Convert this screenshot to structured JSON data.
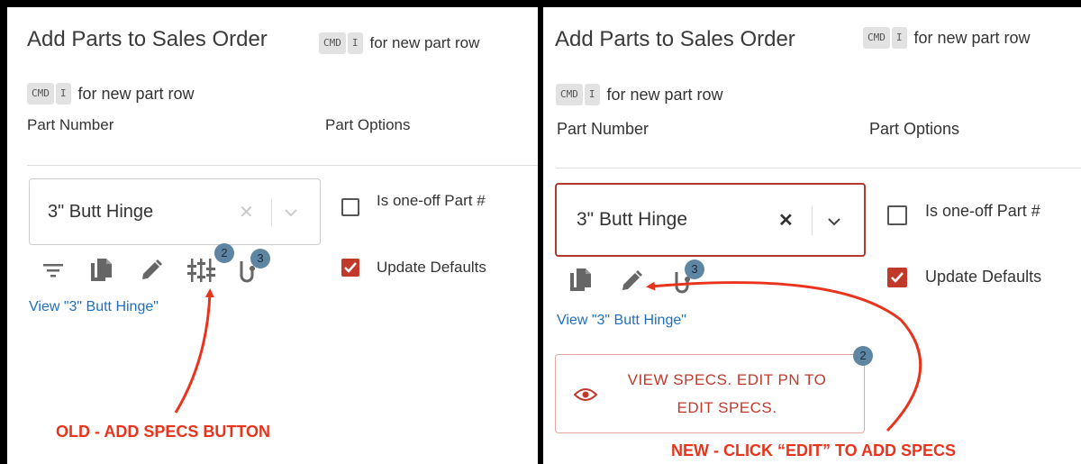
{
  "colors": {
    "accent_red": "#c0392b",
    "arrow_red": "#e8341c",
    "badge_blue": "#5e86a3",
    "link_blue": "#1f6fc0"
  },
  "left": {
    "title": "Add Parts to Sales Order",
    "hint_top": {
      "keys": [
        "CMD",
        "I"
      ],
      "text": "for new part row"
    },
    "hint_row": {
      "keys": [
        "CMD",
        "I"
      ],
      "text": "for new part row"
    },
    "col_part_number": "Part Number",
    "col_part_options": "Part Options",
    "part_select": {
      "value": "3\" Butt Hinge",
      "clear_icon": "close-icon",
      "dropdown_icon": "chevron-down-icon"
    },
    "toolbar_icons": [
      "filter-icon",
      "copy-icon",
      "edit-pencil-icon",
      "specs-icon",
      "hook-icon"
    ],
    "specs_badge": "2",
    "hook_badge": "3",
    "checkbox_one_off": {
      "label": "Is one-off Part #",
      "checked": false
    },
    "checkbox_update_defaults": {
      "label": "Update Defaults",
      "checked": true
    },
    "view_link": "View \"3\" Butt Hinge\"",
    "callout": "OLD - ADD SPECS BUTTON"
  },
  "right": {
    "title": "Add Parts to Sales Order",
    "hint_top": {
      "keys": [
        "CMD",
        "I"
      ],
      "text": "for new part row"
    },
    "hint_row": {
      "keys": [
        "CMD",
        "I"
      ],
      "text": "for new part row"
    },
    "col_part_number": "Part Number",
    "col_part_options": "Part Options",
    "part_select": {
      "value": "3\" Butt Hinge",
      "clear_icon": "close-icon",
      "dropdown_icon": "chevron-down-icon"
    },
    "toolbar_icons": [
      "copy-icon",
      "edit-pencil-icon",
      "hook-icon"
    ],
    "hook_badge": "3",
    "checkbox_one_off": {
      "label": "Is one-off Part #",
      "checked": false
    },
    "checkbox_update_defaults": {
      "label": "Update Defaults",
      "checked": true
    },
    "view_link": "View \"3\" Butt Hinge\"",
    "spec_button": {
      "line1": "VIEW SPECS. EDIT PN TO",
      "line2": "EDIT SPECS.",
      "icon": "eye-icon"
    },
    "spec_badge": "2",
    "callout": "NEW - CLICK “EDIT” TO ADD SPECS"
  }
}
